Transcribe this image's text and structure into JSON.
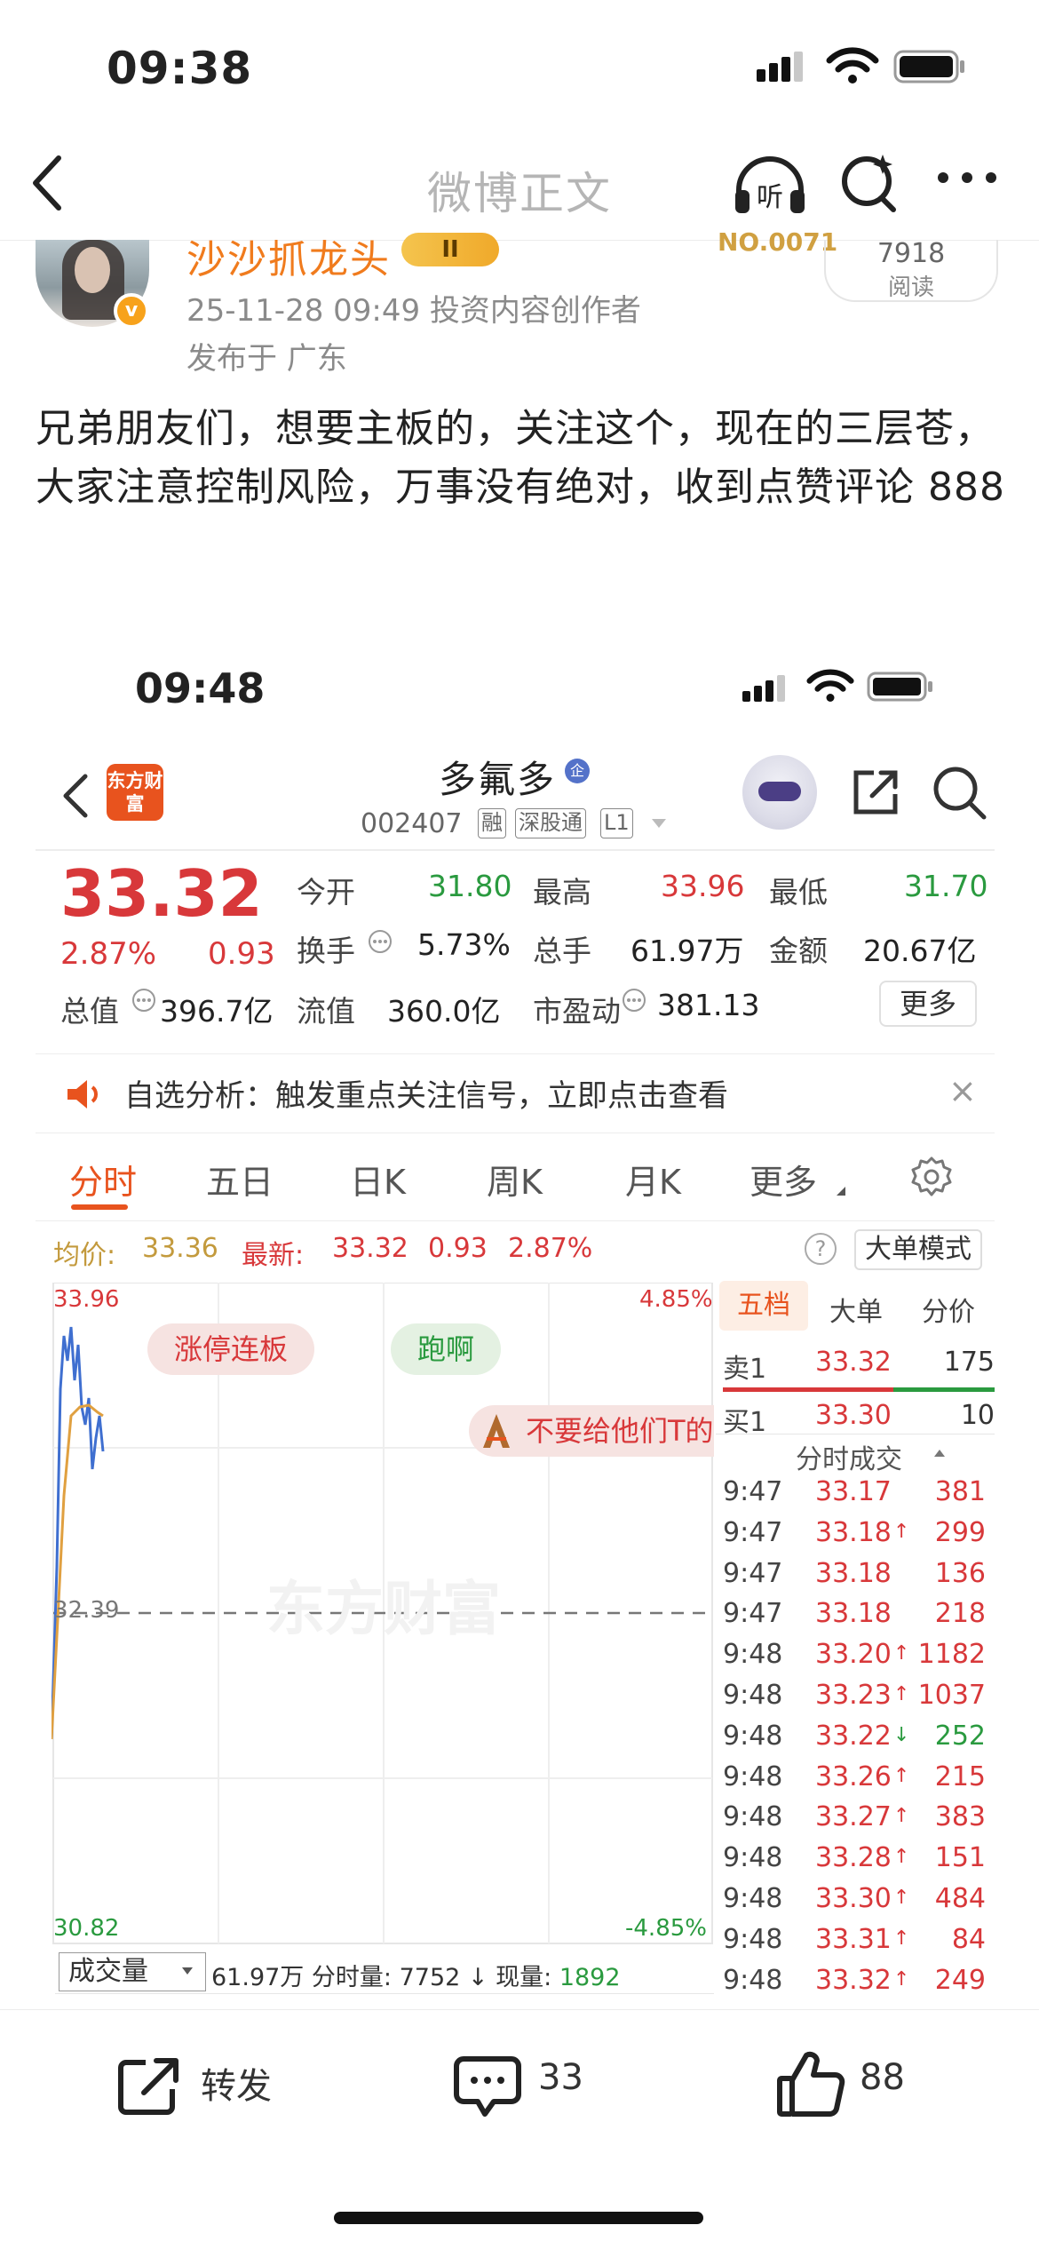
{
  "status_bar": {
    "time": "09:38"
  },
  "nav": {
    "title": "微博正文",
    "listen_label": "听"
  },
  "author": {
    "name": "沙沙抓龙头",
    "level_badge": "II",
    "rank_badge": "NO.0071",
    "reads_count": "7918",
    "reads_label": "阅读",
    "meta": "25-11-28 09:49  投资内容创作者",
    "location": "发布于 广东",
    "verified_badge": "v"
  },
  "post": {
    "text": "兄弟朋友们，想要主板的，关注这个，现在的三层苍，大家注意控制风险，万事没有绝对，收到点赞评论 888"
  },
  "embedded": {
    "status_time": "09:48",
    "app_logo": "东方财富",
    "stock": {
      "name": "多氟多",
      "tag_qi": "企",
      "code": "002407",
      "tags": [
        "融",
        "深股通",
        "L1"
      ]
    },
    "quote": {
      "price": "33.32",
      "change_pct": "2.87%",
      "change_abs": "0.93",
      "rows": [
        [
          {
            "label": "今开",
            "value": "31.80",
            "color": "green"
          },
          {
            "label": "最高",
            "value": "33.96",
            "color": "red"
          },
          {
            "label": "最低",
            "value": "31.70",
            "color": "green"
          }
        ],
        [
          {
            "label": "换手",
            "value": "5.73%",
            "color": "black"
          },
          {
            "label": "总手",
            "value": "61.97万",
            "color": "black"
          },
          {
            "label": "金额",
            "value": "20.67亿",
            "color": "black"
          }
        ],
        [
          {
            "label": "总值",
            "value": "396.7亿",
            "color": "black"
          },
          {
            "label": "流值",
            "value": "360.0亿",
            "color": "black"
          },
          {
            "label": "市盈动",
            "value": "381.13",
            "color": "black"
          }
        ]
      ],
      "more_label": "更多"
    },
    "alert": {
      "text": "自选分析：触发重点关注信号，立即点击查看",
      "close": "×"
    },
    "tabs": [
      "分时",
      "五日",
      "日K",
      "周K",
      "月K",
      "更多"
    ],
    "info": {
      "avg_label": "均价:",
      "avg_value": "33.36",
      "latest_label": "最新:",
      "latest_value": "33.32",
      "latest_chg": "0.93",
      "latest_pct": "2.87%",
      "help": "?",
      "mode_label": "大单模式"
    },
    "chart_labels": {
      "top_price": "33.96",
      "top_pct": "4.85%",
      "mid_price": "32.39",
      "bottom_price": "30.82",
      "bottom_pct": "-4.85%",
      "watermark": "东方财富",
      "bubble1": "涨停连板",
      "bubble2": "跑啊",
      "bubble3": "不要给他们T的"
    },
    "orderbook": {
      "tabs": [
        "五档",
        "大单",
        "分价"
      ],
      "sell": {
        "label": "卖1",
        "price": "33.32",
        "vol": "175"
      },
      "buy": {
        "label": "买1",
        "price": "33.30",
        "vol": "10"
      },
      "trades_title": "分时成交"
    },
    "trades": [
      {
        "time": "9:47",
        "price": "33.17",
        "arrow": "",
        "vol": "381",
        "vc": "red"
      },
      {
        "time": "9:47",
        "price": "33.18",
        "arrow": "↑",
        "vol": "299",
        "vc": "red"
      },
      {
        "time": "9:47",
        "price": "33.18",
        "arrow": "",
        "vol": "136",
        "vc": "red"
      },
      {
        "time": "9:47",
        "price": "33.18",
        "arrow": "",
        "vol": "218",
        "vc": "red"
      },
      {
        "time": "9:48",
        "price": "33.20",
        "arrow": "↑",
        "vol": "1182",
        "vc": "red"
      },
      {
        "time": "9:48",
        "price": "33.23",
        "arrow": "↑",
        "vol": "1037",
        "vc": "red"
      },
      {
        "time": "9:48",
        "price": "33.22",
        "arrow": "↓",
        "vol": "252",
        "vc": "green"
      },
      {
        "time": "9:48",
        "price": "33.26",
        "arrow": "↑",
        "vol": "215",
        "vc": "red"
      },
      {
        "time": "9:48",
        "price": "33.27",
        "arrow": "↑",
        "vol": "383",
        "vc": "red"
      },
      {
        "time": "9:48",
        "price": "33.28",
        "arrow": "↑",
        "vol": "151",
        "vc": "red"
      },
      {
        "time": "9:48",
        "price": "33.30",
        "arrow": "↑",
        "vol": "484",
        "vc": "red"
      },
      {
        "time": "9:48",
        "price": "33.31",
        "arrow": "↑",
        "vol": "84",
        "vc": "red"
      },
      {
        "time": "9:48",
        "price": "33.32",
        "arrow": "↑",
        "vol": "249",
        "vc": "red"
      }
    ],
    "volume_bar": {
      "select_label": "成交量",
      "total": "61.97万",
      "fenshi_label": "分时量:",
      "fenshi_value": "7752",
      "now_label": "现量:",
      "now_value": "1892"
    }
  },
  "toolbar": {
    "repost_label": "转发",
    "comment_count": "33",
    "like_count": "88"
  },
  "colors": {
    "up": "#d8383a",
    "down": "#2a9a3f",
    "accent": "#e8531e",
    "author": "#f07b1d"
  }
}
